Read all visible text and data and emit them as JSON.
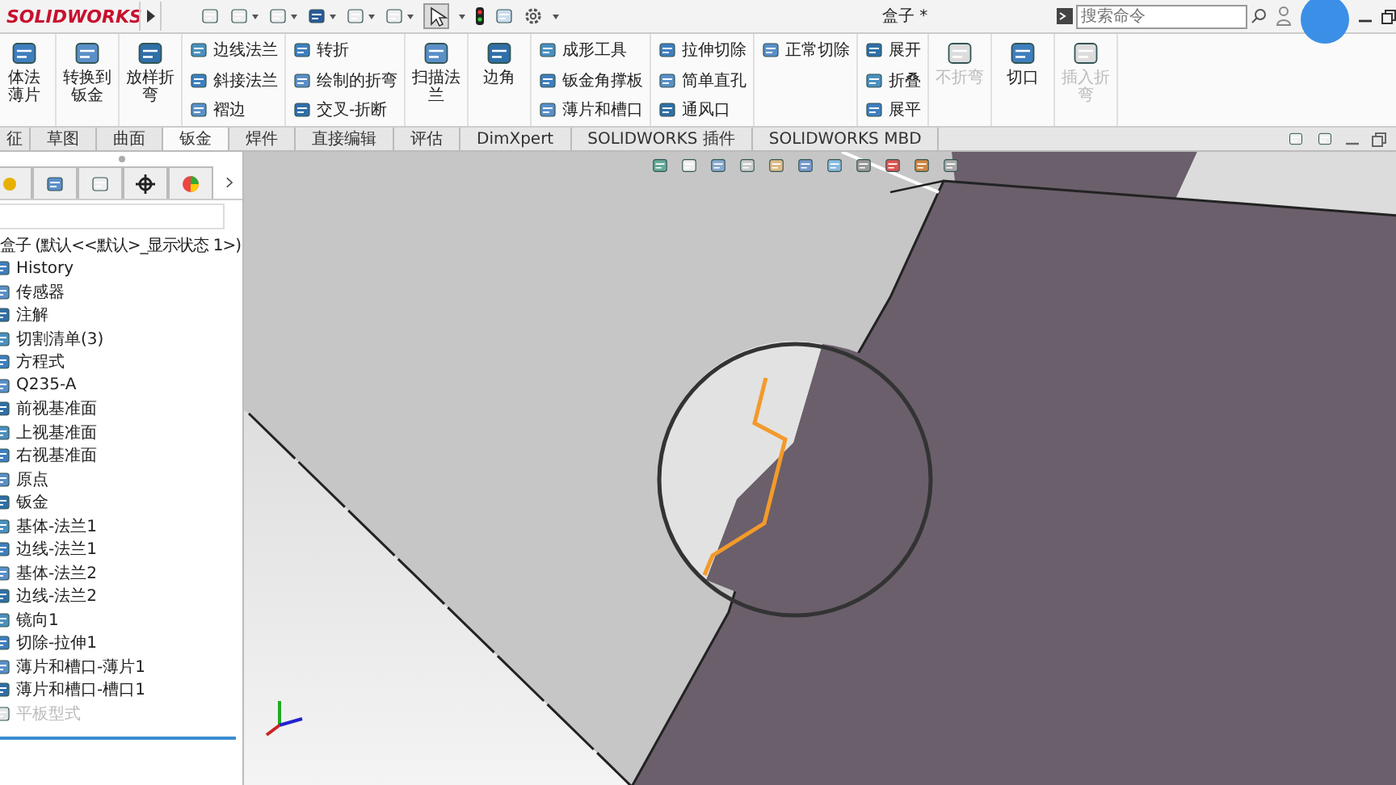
{
  "titlebar": {
    "logo": "SOLIDWORKS",
    "document_title": "盒子 *",
    "search": {
      "placeholder": "搜索命令"
    }
  },
  "ribbon": {
    "groups": [
      {
        "kind": "large",
        "items": [
          {
            "label": "体法薄片",
            "disabled": false
          }
        ]
      },
      {
        "kind": "large",
        "items": [
          {
            "label": "转换到钣金",
            "disabled": false
          }
        ]
      },
      {
        "kind": "large",
        "items": [
          {
            "label": "放样折弯",
            "disabled": false
          }
        ]
      },
      {
        "kind": "small",
        "items": [
          {
            "label": "边线法兰",
            "disabled": false
          },
          {
            "label": "斜接法兰",
            "disabled": false
          },
          {
            "label": "褶边",
            "disabled": false
          }
        ]
      },
      {
        "kind": "small",
        "items": [
          {
            "label": "转折",
            "disabled": false
          },
          {
            "label": "绘制的折弯",
            "disabled": false
          },
          {
            "label": "交叉-折断",
            "disabled": false
          }
        ]
      },
      {
        "kind": "large",
        "items": [
          {
            "label": "扫描法兰",
            "disabled": false
          }
        ]
      },
      {
        "kind": "large",
        "items": [
          {
            "label": "边角",
            "disabled": false
          }
        ]
      },
      {
        "kind": "small",
        "items": [
          {
            "label": "成形工具",
            "disabled": false
          },
          {
            "label": "钣金角撑板",
            "disabled": false
          },
          {
            "label": "薄片和槽口",
            "disabled": false
          }
        ]
      },
      {
        "kind": "small",
        "items": [
          {
            "label": "拉伸切除",
            "disabled": false
          },
          {
            "label": "简单直孔",
            "disabled": false
          },
          {
            "label": "通风口",
            "disabled": false
          }
        ]
      },
      {
        "kind": "small",
        "items": [
          {
            "label": "正常切除",
            "disabled": false
          }
        ]
      },
      {
        "kind": "small",
        "items": [
          {
            "label": "展开",
            "disabled": false
          },
          {
            "label": "折叠",
            "disabled": false
          },
          {
            "label": "展平",
            "disabled": false
          }
        ]
      },
      {
        "kind": "large",
        "items": [
          {
            "label": "不折弯",
            "disabled": true
          }
        ]
      },
      {
        "kind": "large",
        "items": [
          {
            "label": "切口",
            "disabled": false
          }
        ]
      },
      {
        "kind": "large",
        "items": [
          {
            "label": "插入折弯",
            "disabled": true
          }
        ]
      }
    ]
  },
  "tabs": [
    {
      "label": "征",
      "selected": false
    },
    {
      "label": "草图",
      "selected": false
    },
    {
      "label": "曲面",
      "selected": false
    },
    {
      "label": "钣金",
      "selected": true
    },
    {
      "label": "焊件",
      "selected": false
    },
    {
      "label": "直接编辑",
      "selected": false
    },
    {
      "label": "评估",
      "selected": false
    },
    {
      "label": "DimXpert",
      "selected": false
    },
    {
      "label": "SOLIDWORKS 插件",
      "selected": false
    },
    {
      "label": "SOLIDWORKS MBD",
      "selected": false
    }
  ],
  "feature_tree": {
    "root": {
      "label": "盒子 (默认<<默认>_显示状态 1>)",
      "children": [
        {
          "label": "History",
          "disabled": false
        },
        {
          "label": "传感器",
          "disabled": false
        },
        {
          "label": "注解",
          "disabled": false
        },
        {
          "label": "切割清单(3)",
          "disabled": false
        },
        {
          "label": "方程式",
          "disabled": false
        },
        {
          "label": "Q235-A",
          "disabled": false
        },
        {
          "label": "前视基准面",
          "disabled": false
        },
        {
          "label": "上视基准面",
          "disabled": false
        },
        {
          "label": "右视基准面",
          "disabled": false
        },
        {
          "label": "原点",
          "disabled": false
        },
        {
          "label": "钣金",
          "disabled": false
        },
        {
          "label": "基体-法兰1",
          "disabled": false
        },
        {
          "label": "边线-法兰1",
          "disabled": false
        },
        {
          "label": "基体-法兰2",
          "disabled": false
        },
        {
          "label": "边线-法兰2",
          "disabled": false
        },
        {
          "label": "镜向1",
          "disabled": false
        },
        {
          "label": "切除-拉伸1",
          "disabled": false
        },
        {
          "label": "薄片和槽口-薄片1",
          "disabled": false
        },
        {
          "label": "薄片和槽口-槽口1",
          "disabled": false
        },
        {
          "label": "平板型式",
          "disabled": true
        }
      ]
    }
  }
}
